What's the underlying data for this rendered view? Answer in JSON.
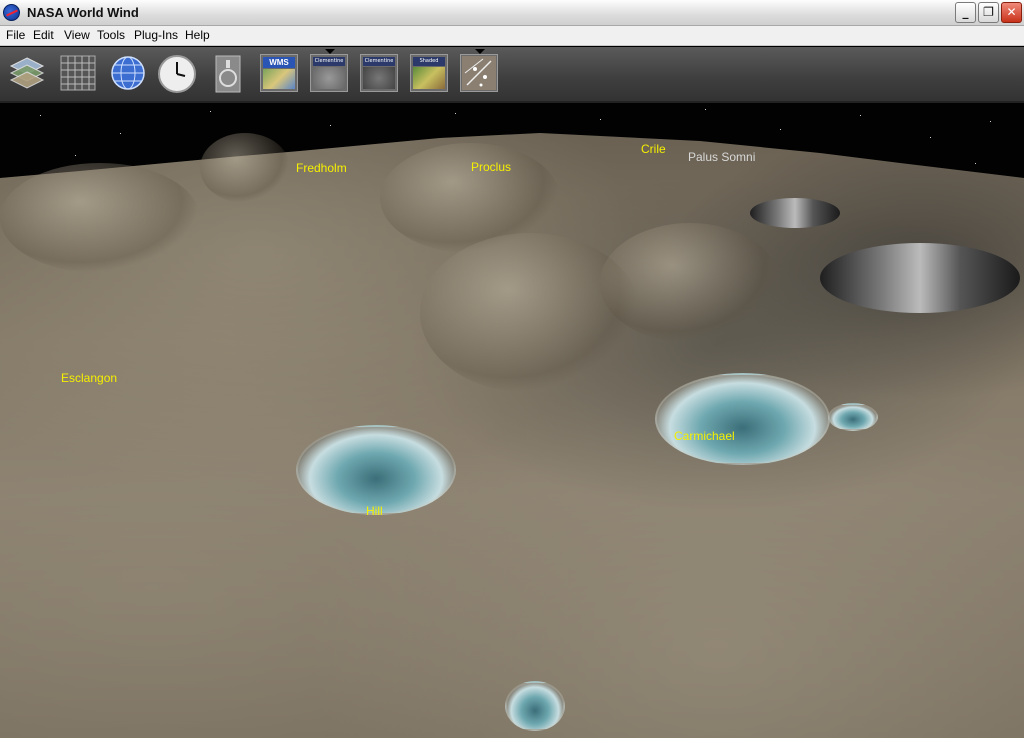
{
  "window": {
    "title": "NASA World Wind",
    "controls": {
      "minimize": "_",
      "maximize": "❐",
      "close": "✕"
    }
  },
  "menu": [
    "File",
    "Edit",
    "View",
    "Tools",
    "Plug-Ins",
    "Help"
  ],
  "toolbar": {
    "tools": [
      {
        "name": "layer-stack-icon"
      },
      {
        "name": "lat-lon-grid-icon"
      },
      {
        "name": "globe-icon"
      },
      {
        "name": "clock-icon"
      },
      {
        "name": "compass-icon"
      },
      {
        "name": "wms-icon",
        "text": "WMS"
      },
      {
        "name": "clementine-40xx-icon",
        "text": "Clementine 40xx"
      },
      {
        "name": "clementine-30xx-icon",
        "text": "Clementine 30xx"
      },
      {
        "name": "shaded-relief-icon",
        "text": "Shaded Relief"
      },
      {
        "name": "place-names-icon"
      }
    ]
  },
  "map": {
    "labels": [
      {
        "text": "Fredholm",
        "color": "#f6f000"
      },
      {
        "text": "Proclus",
        "color": "#f6f000"
      },
      {
        "text": "Crile",
        "color": "#f6f000"
      },
      {
        "text": "Palus Somni",
        "color": "#d8d8d8"
      },
      {
        "text": "Esclangon",
        "color": "#f6f000"
      },
      {
        "text": "Carmichael",
        "color": "#f6f000"
      },
      {
        "text": "Hill",
        "color": "#f6f000"
      }
    ]
  }
}
